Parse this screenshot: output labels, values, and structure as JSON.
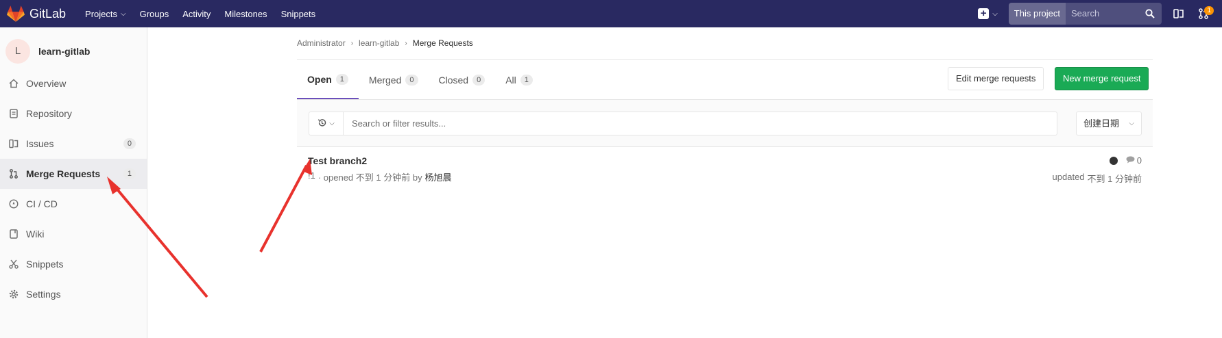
{
  "navbar": {
    "brand": "GitLab",
    "links": [
      {
        "label": "Projects",
        "has_dropdown": true
      },
      {
        "label": "Groups"
      },
      {
        "label": "Activity"
      },
      {
        "label": "Milestones"
      },
      {
        "label": "Snippets"
      }
    ],
    "search_scope": "This project",
    "search_placeholder": "Search",
    "todo_count": "1",
    "colors": {
      "bg": "#292961",
      "badge": "#fc9403"
    }
  },
  "sidebar": {
    "project_avatar_letter": "L",
    "project_name": "learn-gitlab",
    "items": [
      {
        "label": "Overview",
        "icon": "home-icon"
      },
      {
        "label": "Repository",
        "icon": "doc-icon"
      },
      {
        "label": "Issues",
        "icon": "issues-icon",
        "count": "0"
      },
      {
        "label": "Merge Requests",
        "icon": "merge-request-icon",
        "count": "1",
        "active": true
      },
      {
        "label": "CI / CD",
        "icon": "rocket-icon"
      },
      {
        "label": "Wiki",
        "icon": "book-icon"
      },
      {
        "label": "Snippets",
        "icon": "scissors-icon"
      },
      {
        "label": "Settings",
        "icon": "gear-icon"
      }
    ]
  },
  "breadcrumb": {
    "items": [
      "Administrator",
      "learn-gitlab",
      "Merge Requests"
    ]
  },
  "tabs": [
    {
      "label": "Open",
      "count": "1",
      "active": true
    },
    {
      "label": "Merged",
      "count": "0"
    },
    {
      "label": "Closed",
      "count": "0"
    },
    {
      "label": "All",
      "count": "1"
    }
  ],
  "buttons": {
    "edit": "Edit merge requests",
    "new": "New merge request"
  },
  "filter": {
    "placeholder": "Search or filter results...",
    "sort_label": "创建日期"
  },
  "merge_requests": [
    {
      "title": "Test branch2",
      "ref": "!1",
      "opened_text": "· opened 不到 1 分钟前 by",
      "author": "杨旭晨",
      "comments": "0",
      "updated_label": "updated",
      "updated_time": "不到 1 分钟前"
    }
  ]
}
